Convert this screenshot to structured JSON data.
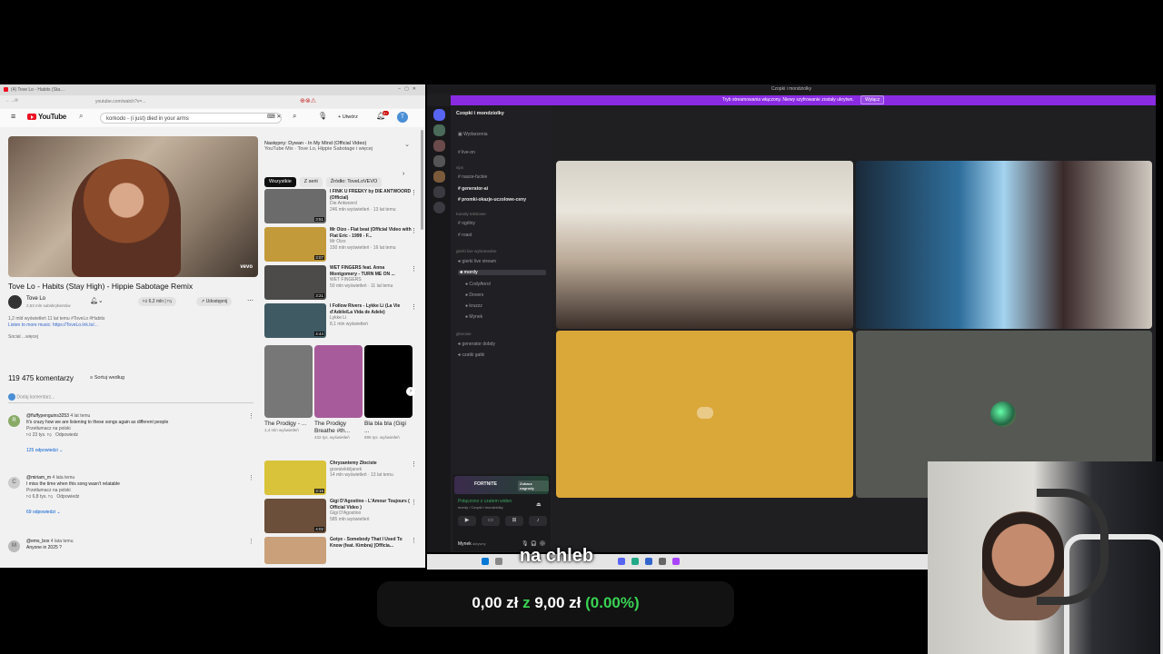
{
  "youtube": {
    "tab_title": "(4) Tove Lo - Habits (Stay...",
    "address": "youtube.com/watch?v=...",
    "logo": "YouTube",
    "search_value": "korkodo - (i just) died in your arms",
    "create_label": "Utwórz",
    "notif_count": "9+",
    "profile_initial": "T",
    "video_title": "Tove Lo - Habits (Stay High) - Hippie Sabotage Remix",
    "vevo": "vevo",
    "channel_name": "Tove Lo",
    "subscribers": "2,53 mln subskrybentów",
    "likes": "6,2 mln",
    "share_label": "Udostępnij",
    "description_line1": "1,2 mld wyświetleń  11 lat temu  #ToveLo #Habits",
    "description_line2": "Listen to more music: https://ToveLo.lnk.to/...",
    "description_more": "Social ...więcej",
    "comments_count": "119 475 komentarzy",
    "sort_label": "Sortuj według",
    "add_comment": "Dodaj komentarz...",
    "comments": [
      {
        "user": "@fluffypenguins3253",
        "time": "4 lat temu",
        "text": "It's crazy how we are listening to these songs again as different people",
        "translate": "Przetłumacz na polski",
        "replies": "125 odpowiedzi",
        "avatar": "R"
      },
      {
        "user": "@miriam_m",
        "time": "4 lata temu",
        "text": "I miss the time when this song wasn't relatable",
        "translate": "Przetłumacz na polski",
        "replies": "69 odpowiedzi",
        "avatar": "C"
      },
      {
        "user": "@ems_box",
        "time": "4 lata temu",
        "text": "Anyone in 2025 ?",
        "translate": "",
        "replies": "",
        "avatar": "M"
      }
    ],
    "next_label": "Następny: Dywan - In My Mind (Official Video)",
    "next_sub": "YouTube Mix · Tove Lo, Hippie Sabotage i więcej",
    "chips": [
      "Wszystkie",
      "Z serii",
      "Źródło: ToveLoVEVO"
    ],
    "recommended": [
      {
        "title": "I FINK U FREEKY by DIE ANTWOORD (Official)",
        "channel": "Die Antwoord",
        "meta": "246 mln wyświetleń · 13 lat temu",
        "duration": "3:51",
        "color": "#6b6b6b"
      },
      {
        "title": "Mr Oizo - Flat beat (Official Video with Flat Eric - 1999 - F...",
        "channel": "Mr Oizo",
        "meta": "150 mln wyświetleń · 16 lat temu",
        "duration": "3:07",
        "color": "#c39a3a"
      },
      {
        "title": "WET FINGERS feat. Anna Montgomery - TURN ME ON ...",
        "channel": "WET FINGERS",
        "meta": "50 mln wyświetleń · 11 lat temu",
        "duration": "3:21",
        "color": "#4d4a4a"
      },
      {
        "title": "I Follow Rivers - Lykke Li (La Vie d'Adèle/La Vida de Adele)",
        "channel": "Lykke Li",
        "meta": "8,1 mln wyświetleń",
        "duration": "4:44",
        "color": "#3f5a63"
      }
    ],
    "shorts": [
      {
        "title": "The Prodigy - ...",
        "views": "1,4 mln wyświetleń",
        "color": "#777"
      },
      {
        "title": "The Prodigy Breathe #th...",
        "views": "432 tys. wyświetleń",
        "color": "#a75b9a"
      },
      {
        "title": "Bla bla bla (Gigi ...",
        "views": "895 tys. wyświetleń",
        "color": "#000"
      }
    ],
    "recommended2": [
      {
        "title": "Chryzantemy Złociste",
        "channel": "grzesiekkiljanek",
        "meta": "14 mln wyświetleń · 13 lat temu",
        "duration": "3:15",
        "color": "#d9c33a"
      },
      {
        "title": "Gigi D'Agostino - L'Amour Toujours ( Official Video )",
        "channel": "Gigi D'Agostino",
        "meta": "585 mln wyświetleń",
        "duration": "4:02",
        "color": "#6b4f3a"
      },
      {
        "title": "Gotye - Somebody That I Used To Know (feat. Kimbra) [Officia...",
        "channel": "",
        "meta": "",
        "duration": "",
        "color": "#c9a07a"
      }
    ]
  },
  "discord": {
    "window_title": "Czopki i mondziolky",
    "banner_text": "Tryb streamowania włączony. Niewy szyfrowanie zostały ukrytwn.",
    "banner_button": "Wyłącz",
    "server_name": "Czopki i mondziolky",
    "events_label": "Wydarzenia",
    "channels_top": [
      "live-on"
    ],
    "category1": "vips",
    "channels_mid": [
      "nasze-fuckie",
      "generator-ai",
      "promki-okazje-uczolowe-ceny"
    ],
    "category2": "Kanały tekstowe",
    "channels_text": [
      "ogólny",
      "roast"
    ],
    "category3": "gierki live wybranedne",
    "voice_channels": [
      "gierki live stream",
      "mordy"
    ],
    "voice_users": [
      "CodyAnrol",
      "Dovers",
      "kruzzz",
      "Mynek"
    ],
    "category4": "głosowe",
    "voice_channels2": [
      "generator dobdy",
      "czatki gatki"
    ],
    "game": "FORTNITE",
    "game_button": "Zobacz nagrody",
    "vc_status": "Połączono z czatem wideo",
    "vc_channel": "mordy / Czopki i mondziolky",
    "user_name": "Mynek",
    "user_status": "aktywny"
  },
  "overlay": {
    "subtitle": "na chleb",
    "donation_current": "0,00 zł",
    "donation_sep": "z",
    "donation_goal": "9,00 zł",
    "donation_pct": "(0.00%)",
    "colors": {
      "white": "#ffffff",
      "green": "#39d353",
      "yellow": "#daa739",
      "purple": "#8a2be2"
    }
  }
}
